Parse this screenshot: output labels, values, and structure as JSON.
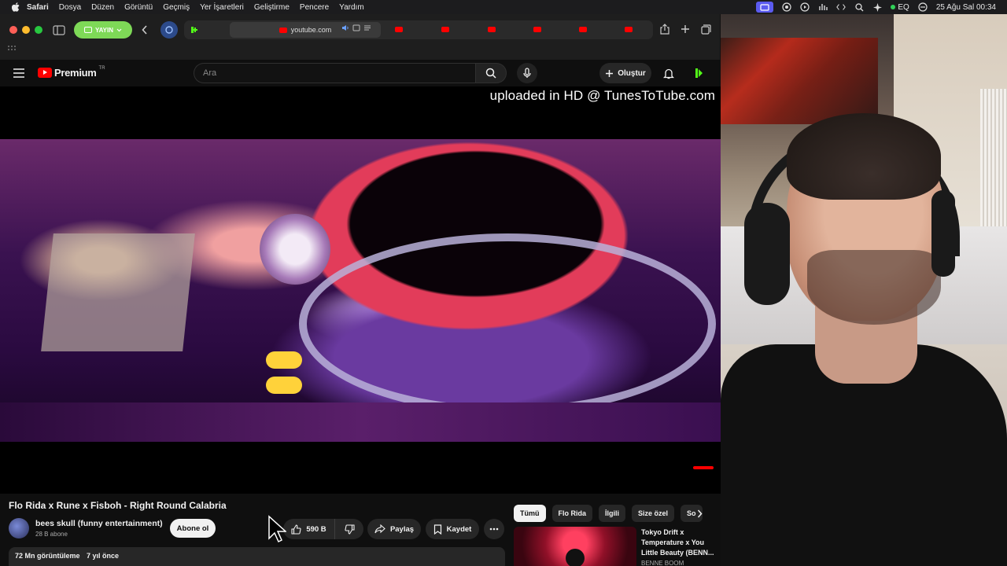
{
  "menubar": {
    "app": "Safari",
    "items": [
      "Dosya",
      "Düzen",
      "Görüntü",
      "Geçmiş",
      "Yer İşaretleri",
      "Geliştirme",
      "Pencere",
      "Yardım"
    ],
    "eq_label": "EQ",
    "clock": "25 Ağu Sal  00:34"
  },
  "safari": {
    "profile_label": "YAYIN",
    "url": "youtube.com",
    "tab_count_youtube": 6
  },
  "youtube": {
    "logo_text": "Premium",
    "country_code": "TR",
    "search_placeholder": "Ara",
    "create_label": "Oluştur"
  },
  "player": {
    "watermark": "uploaded in HD @ TunesToTube.com"
  },
  "video": {
    "title": "Flo Rida x Rune x Fisboh - Right Round Calabria",
    "channel_name": "bees skull (funny entertainment)",
    "subscribers": "28 B abone",
    "subscribe_label": "Abone ol",
    "likes": "590 B",
    "share_label": "Paylaş",
    "save_label": "Kaydet",
    "views": "72 Mn görüntüleme",
    "age": "7 yıl önce"
  },
  "chips": [
    "Tümü",
    "Flo Rida",
    "İlgili",
    "Size özel",
    "So"
  ],
  "recommendation": {
    "title": "Tokyo Drift x Temperature x You Little Beauty (BENN...",
    "channel": "BENNE BOOM"
  },
  "colors": {
    "yt_red": "#ff0000",
    "profile_green": "#7ed957",
    "accent_purple": "#5b5bf0"
  }
}
